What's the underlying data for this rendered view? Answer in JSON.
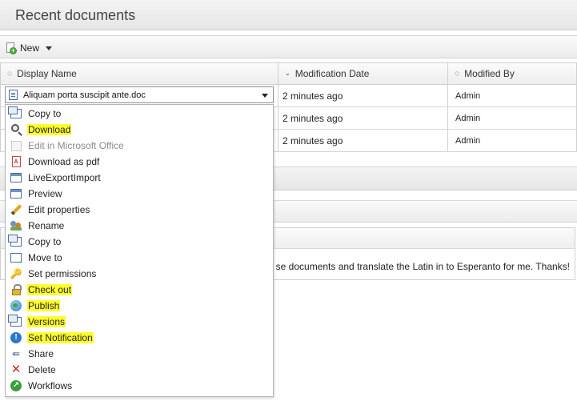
{
  "panel": {
    "title": "Recent documents"
  },
  "toolbar": {
    "new_label": "New"
  },
  "grid": {
    "columns": [
      {
        "label": "Display Name",
        "sort_icon": "sort-neutral-icon"
      },
      {
        "label": "Modification Date",
        "sort_icon": "sort-desc-icon"
      },
      {
        "label": "Modified By",
        "sort_icon": "sort-neutral-icon"
      }
    ],
    "rows": [
      {
        "name": "Aliquam porta suscipit ante.doc",
        "modified": "2 minutes ago",
        "by": "Admin"
      },
      {
        "name": "",
        "modified": "2 minutes ago",
        "by": "Admin"
      },
      {
        "name": "",
        "modified": "2 minutes ago",
        "by": "Admin"
      }
    ]
  },
  "context_menu": {
    "items": [
      {
        "label": "Copy to",
        "icon": "copy-icon",
        "highlighted": false,
        "disabled": false
      },
      {
        "label": "Download",
        "icon": "magnifier-icon",
        "highlighted": true,
        "disabled": false
      },
      {
        "label": "Edit in Microsoft Office",
        "icon": "office-icon",
        "highlighted": false,
        "disabled": true
      },
      {
        "label": "Download as pdf",
        "icon": "pdf-icon",
        "highlighted": false,
        "disabled": false
      },
      {
        "label": "LiveExportImport",
        "icon": "window-icon",
        "highlighted": false,
        "disabled": false
      },
      {
        "label": "Preview",
        "icon": "window-icon",
        "highlighted": false,
        "disabled": false
      },
      {
        "label": "Edit properties",
        "icon": "pencil-icon",
        "highlighted": false,
        "disabled": false
      },
      {
        "label": "Rename",
        "icon": "users-icon",
        "highlighted": false,
        "disabled": false
      },
      {
        "label": "Copy to",
        "icon": "copy-icon",
        "highlighted": false,
        "disabled": false
      },
      {
        "label": "Move to",
        "icon": "move-icon",
        "highlighted": false,
        "disabled": false
      },
      {
        "label": "Set permissions",
        "icon": "key-icon",
        "highlighted": false,
        "disabled": false
      },
      {
        "label": "Check out",
        "icon": "lock-icon",
        "highlighted": true,
        "disabled": false
      },
      {
        "label": "Publish",
        "icon": "globe-icon",
        "highlighted": true,
        "disabled": false
      },
      {
        "label": "Versions",
        "icon": "versions-icon",
        "highlighted": true,
        "disabled": false
      },
      {
        "label": "Set Notification",
        "icon": "notification-icon",
        "highlighted": true,
        "disabled": false
      },
      {
        "label": "Share",
        "icon": "share-icon",
        "highlighted": false,
        "disabled": false
      },
      {
        "label": "Delete",
        "icon": "delete-icon",
        "highlighted": false,
        "disabled": false
      },
      {
        "label": "Workflows",
        "icon": "workflows-icon",
        "highlighted": false,
        "disabled": false
      }
    ]
  },
  "background": {
    "message_fragment": "se documents and translate the Latin in to Esperanto for me. Thanks!"
  },
  "colors": {
    "highlight": "#ffff2e",
    "disabled_text": "#8a8a8a"
  }
}
